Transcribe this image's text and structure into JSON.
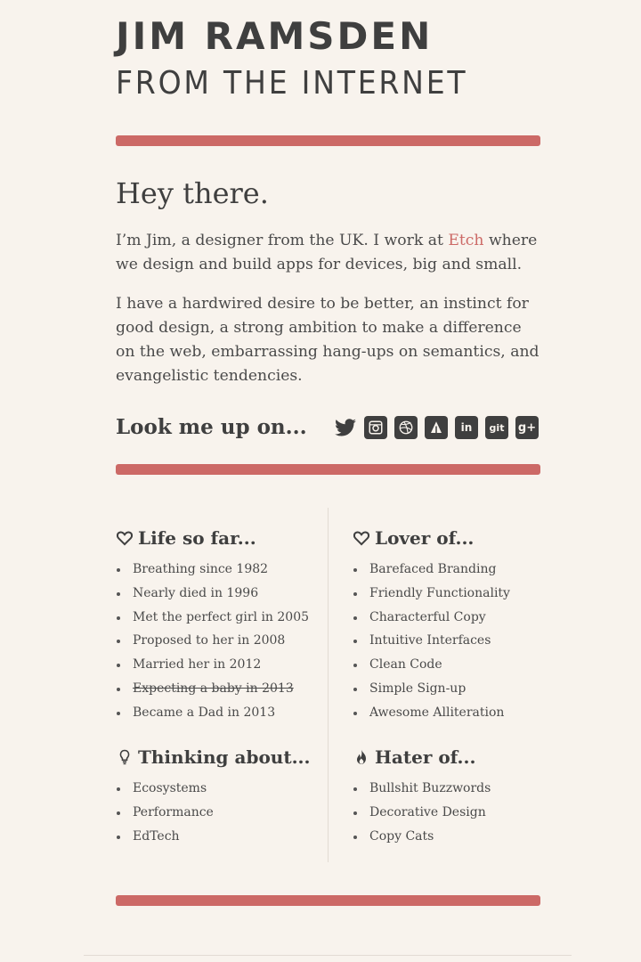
{
  "header": {
    "name": "JIM RAMSDEN",
    "tagline": "FROM THE INTERNET"
  },
  "intro": {
    "title": "Hey there.",
    "p1_before": "I’m Jim, a designer from the UK. I work at ",
    "p1_link": "Etch",
    "p1_after": " where we design and build apps for devices, big and small.",
    "p2": "I have a hardwired desire to be better, an instinct for good design, a strong ambition to make a difference on the web, embarrassing hang-ups on semantics, and evangelistic tendencies."
  },
  "social": {
    "heading": "Look me up on...",
    "items": [
      {
        "icon": "twitter-icon"
      },
      {
        "icon": "instagram-icon"
      },
      {
        "icon": "dribbble-icon"
      },
      {
        "icon": "forrst-icon"
      },
      {
        "icon": "linkedin-icon",
        "text": "in"
      },
      {
        "icon": "git-icon",
        "text": "git"
      },
      {
        "icon": "google-plus-icon",
        "text": "g+"
      }
    ]
  },
  "sections": {
    "life": {
      "title": "Life so far...",
      "icon": "heart-icon",
      "items": [
        "Breathing since 1982",
        "Nearly died in 1996",
        "Met the perfect girl in 2005",
        "Proposed to her in 2008",
        "Married her in 2012",
        "Expecting a baby in 2013",
        "Became a Dad in 2013"
      ]
    },
    "lover": {
      "title": "Lover of...",
      "icon": "heart-icon",
      "items": [
        "Barefaced Branding",
        "Friendly Functionality",
        "Characterful Copy",
        "Intuitive Interfaces",
        "Clean Code",
        "Simple Sign-up",
        "Awesome Alliteration"
      ]
    },
    "thinking": {
      "title": "Thinking about...",
      "icon": "lightbulb-icon",
      "items": [
        "Ecosystems",
        "Performance",
        "EdTech"
      ]
    },
    "hater": {
      "title": "Hater of...",
      "icon": "flame-icon",
      "items": [
        "Bullshit Buzzwords",
        "Decorative Design",
        "Copy Cats"
      ]
    }
  },
  "colors": {
    "background": "#f8f3ed",
    "accent": "#cc6966",
    "text": "#3f3f3f"
  }
}
